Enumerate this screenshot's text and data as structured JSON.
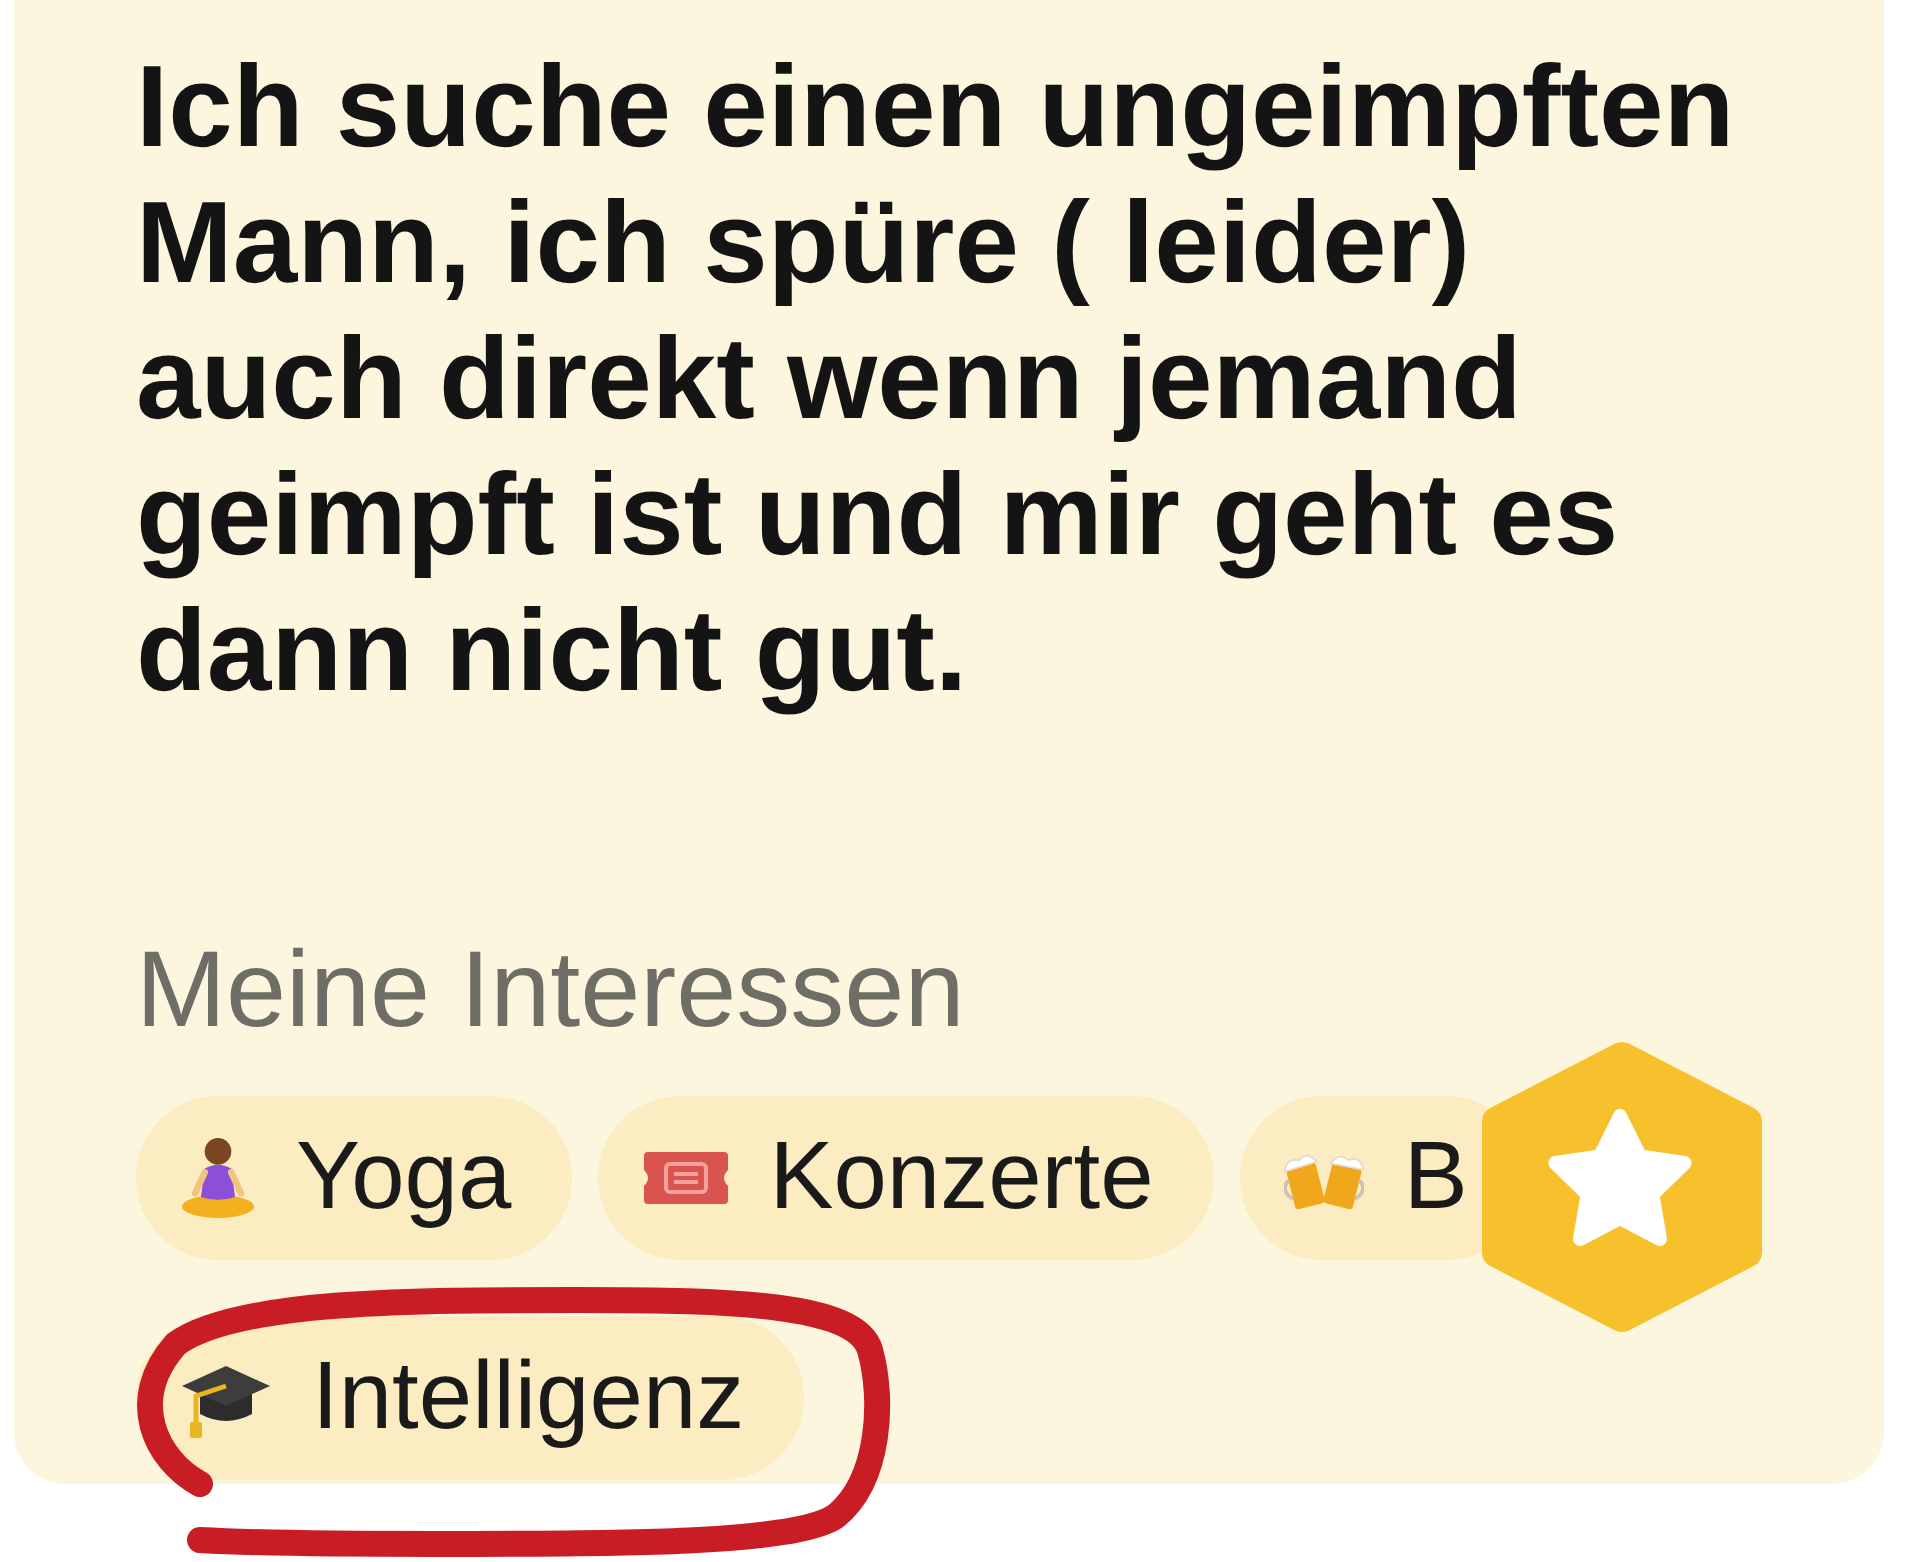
{
  "profile_card": {
    "bio": "Ich suche einen ungeimpften Mann, ich spüre ( leider) auch direkt wenn jemand geimpft ist und mir geht es dann nicht gut.",
    "interests": {
      "heading": "Meine Interessen",
      "chips": [
        {
          "label": "Yoga"
        },
        {
          "label": "Konzerte"
        },
        {
          "label": "B"
        },
        {
          "label": "Intelligenz"
        }
      ]
    }
  }
}
